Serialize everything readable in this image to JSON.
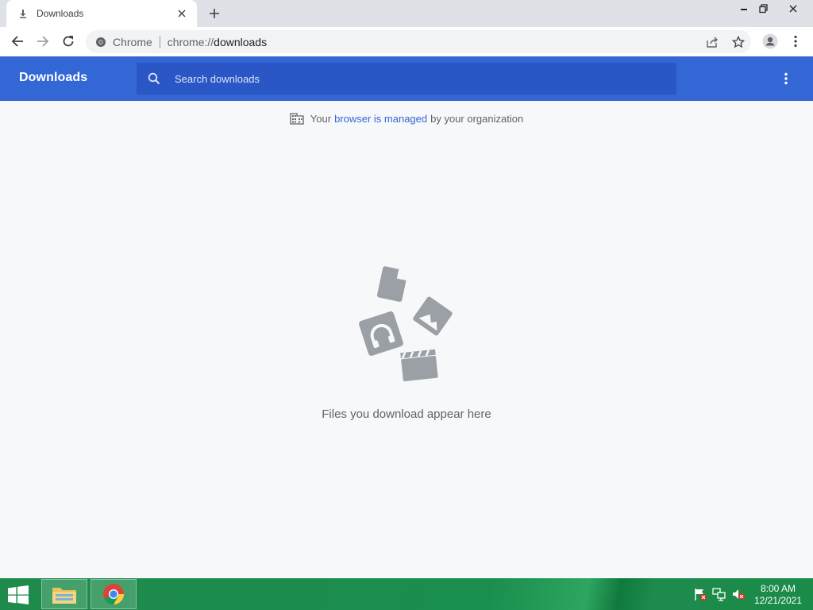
{
  "tab": {
    "title": "Downloads",
    "icon": "download-icon"
  },
  "toolbar": {
    "site_chip": "Chrome",
    "url_prefix": "chrome://",
    "url_host": "downloads"
  },
  "page": {
    "title": "Downloads",
    "search_placeholder": "Search downloads",
    "managed_prefix": "Your",
    "managed_link": "browser is managed",
    "managed_suffix": "by your organization",
    "empty_message": "Files you download appear here"
  },
  "taskbar": {
    "time": "8:00 AM",
    "date": "12/21/2021"
  },
  "colors": {
    "header_blue": "#3367d6",
    "search_blue": "#2a56c6",
    "link_blue": "#3367d6",
    "empty_art_gray": "#9aa0a6",
    "taskbar_green": "#1e8a4c"
  }
}
